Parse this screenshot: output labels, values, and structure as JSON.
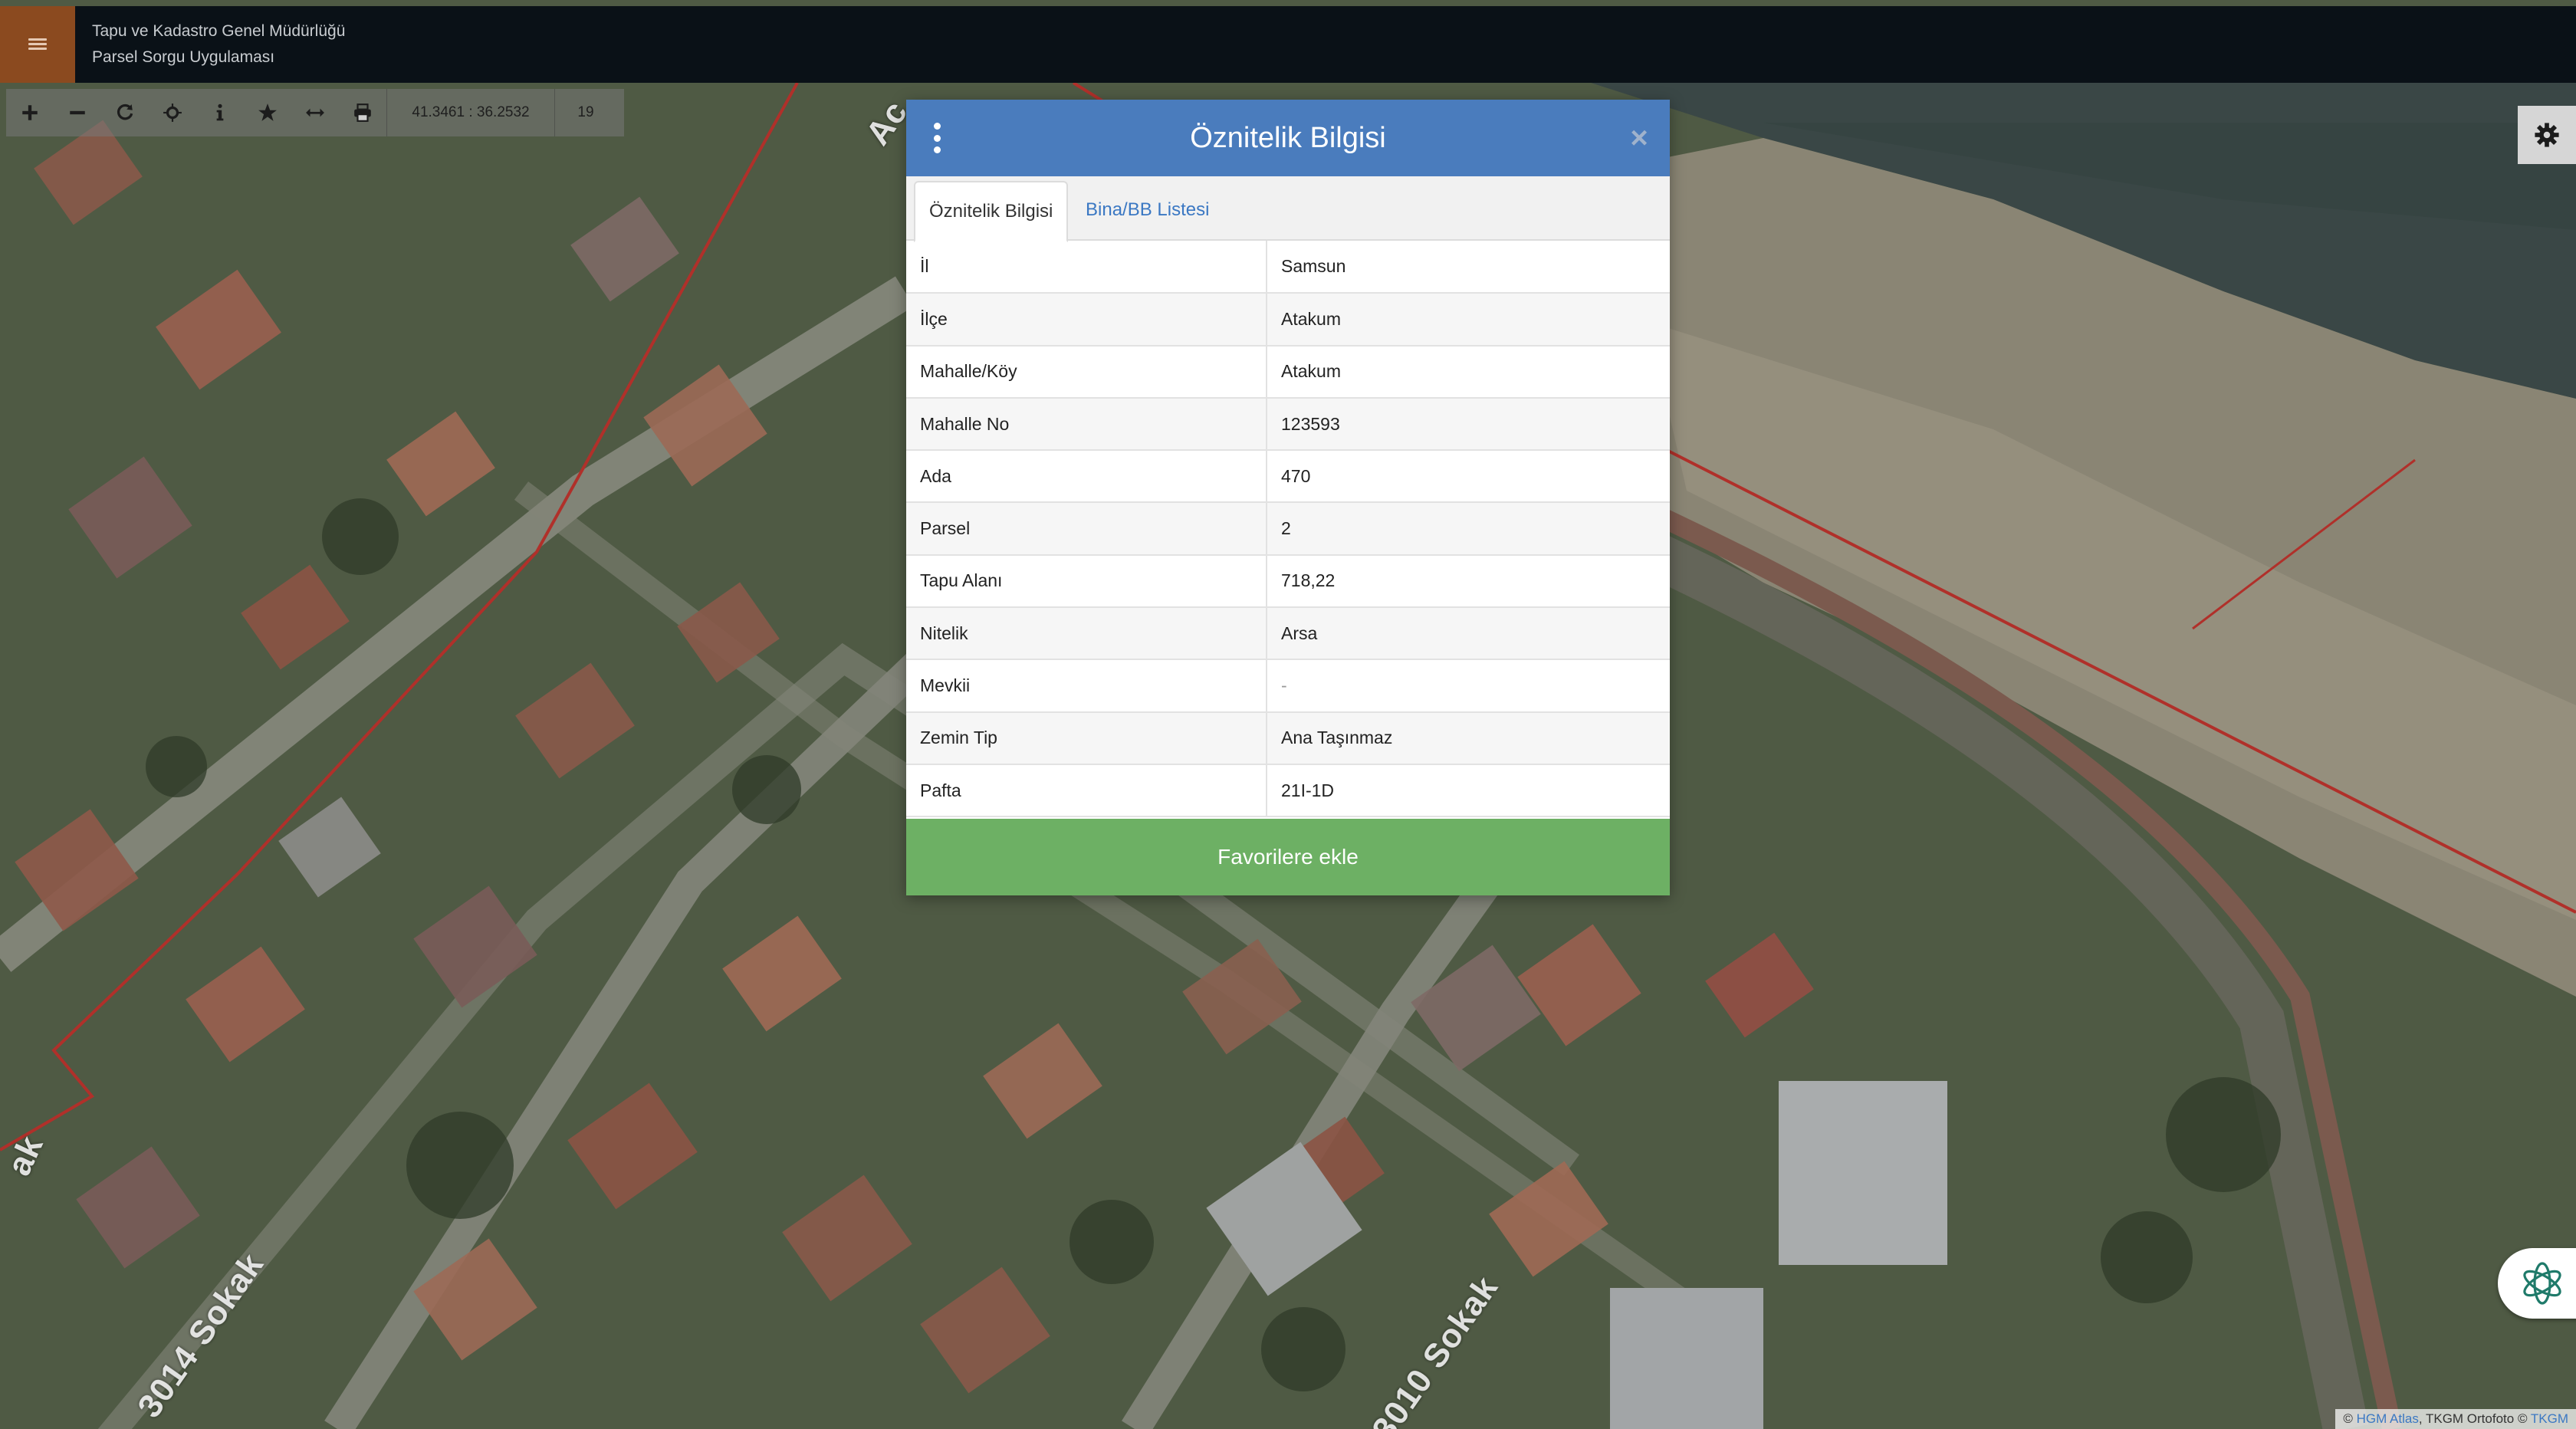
{
  "header": {
    "org_name": "Tapu ve Kadastro Genel Müdürlüğü",
    "app_name": "Parsel Sorgu Uygulaması",
    "menu_icon": "hamburger-icon",
    "background_color": "#0a1117",
    "menu_color": "#8b4a1f"
  },
  "toolbar": {
    "tools": [
      {
        "name": "zoom-in",
        "icon": "plus-icon"
      },
      {
        "name": "zoom-out",
        "icon": "minus-icon"
      },
      {
        "name": "refresh",
        "icon": "refresh-icon"
      },
      {
        "name": "locate",
        "icon": "crosshair-icon"
      },
      {
        "name": "info",
        "icon": "info-icon"
      },
      {
        "name": "favorites",
        "icon": "star-icon"
      },
      {
        "name": "measure",
        "icon": "measure-icon"
      },
      {
        "name": "print",
        "icon": "print-icon"
      }
    ],
    "coordinates": "41.3461 : 36.2532",
    "zoom_level": "19"
  },
  "modal": {
    "title": "Öznitelik Bilgisi",
    "header_color": "#4a7cbd",
    "tabs": [
      {
        "label": "Öznitelik Bilgisi",
        "active": true
      },
      {
        "label": "Bina/BB Listesi",
        "active": false
      }
    ],
    "rows": [
      {
        "key": "İl",
        "value": "Samsun"
      },
      {
        "key": "İlçe",
        "value": "Atakum"
      },
      {
        "key": "Mahalle/Köy",
        "value": "Atakum"
      },
      {
        "key": "Mahalle No",
        "value": "123593"
      },
      {
        "key": "Ada",
        "value": "470"
      },
      {
        "key": "Parsel",
        "value": "2"
      },
      {
        "key": "Tapu Alanı",
        "value": "718,22"
      },
      {
        "key": "Nitelik",
        "value": "Arsa"
      },
      {
        "key": "Mevkii",
        "value": "-"
      },
      {
        "key": "Zemin Tip",
        "value": "Ana Taşınmaz"
      },
      {
        "key": "Pafta",
        "value": "21I-1D"
      }
    ],
    "favorite_button": "Favorilere ekle",
    "favorite_color": "#6db064"
  },
  "map": {
    "street_labels": [
      "3014 Sokak",
      "3010 Sokak",
      "Ac",
      "ak"
    ],
    "parcel_line_color": "#b0302a"
  },
  "attribution": {
    "prefix": "©",
    "hgm": "HGM Atlas",
    "middle": ", TKGM Ortofoto ©",
    "tkgm": "TKGM"
  }
}
